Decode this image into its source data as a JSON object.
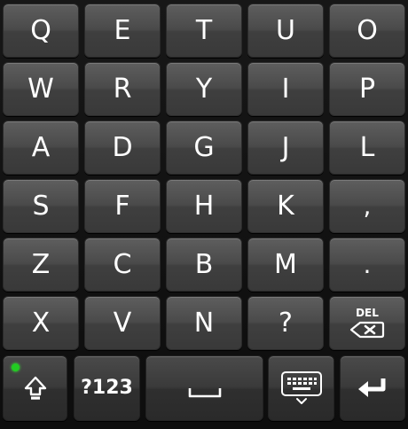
{
  "keyboard": {
    "rows": [
      [
        "Q",
        "E",
        "T",
        "U",
        "O"
      ],
      [
        "W",
        "R",
        "Y",
        "I",
        "P"
      ],
      [
        "A",
        "D",
        "G",
        "J",
        "L"
      ],
      [
        "S",
        "F",
        "H",
        "K",
        ","
      ],
      [
        "Z",
        "C",
        "B",
        "M",
        "."
      ],
      [
        "X",
        "V",
        "N",
        "?"
      ]
    ],
    "del_label": "DEL",
    "symbols_label": "?123",
    "shift_indicator_color": "#22cc22",
    "icons": {
      "shift": "shift-arrow-icon",
      "delete": "backspace-icon",
      "space": "space-bar-icon",
      "hide_keyboard": "keyboard-hide-icon",
      "enter": "enter-return-icon"
    }
  }
}
